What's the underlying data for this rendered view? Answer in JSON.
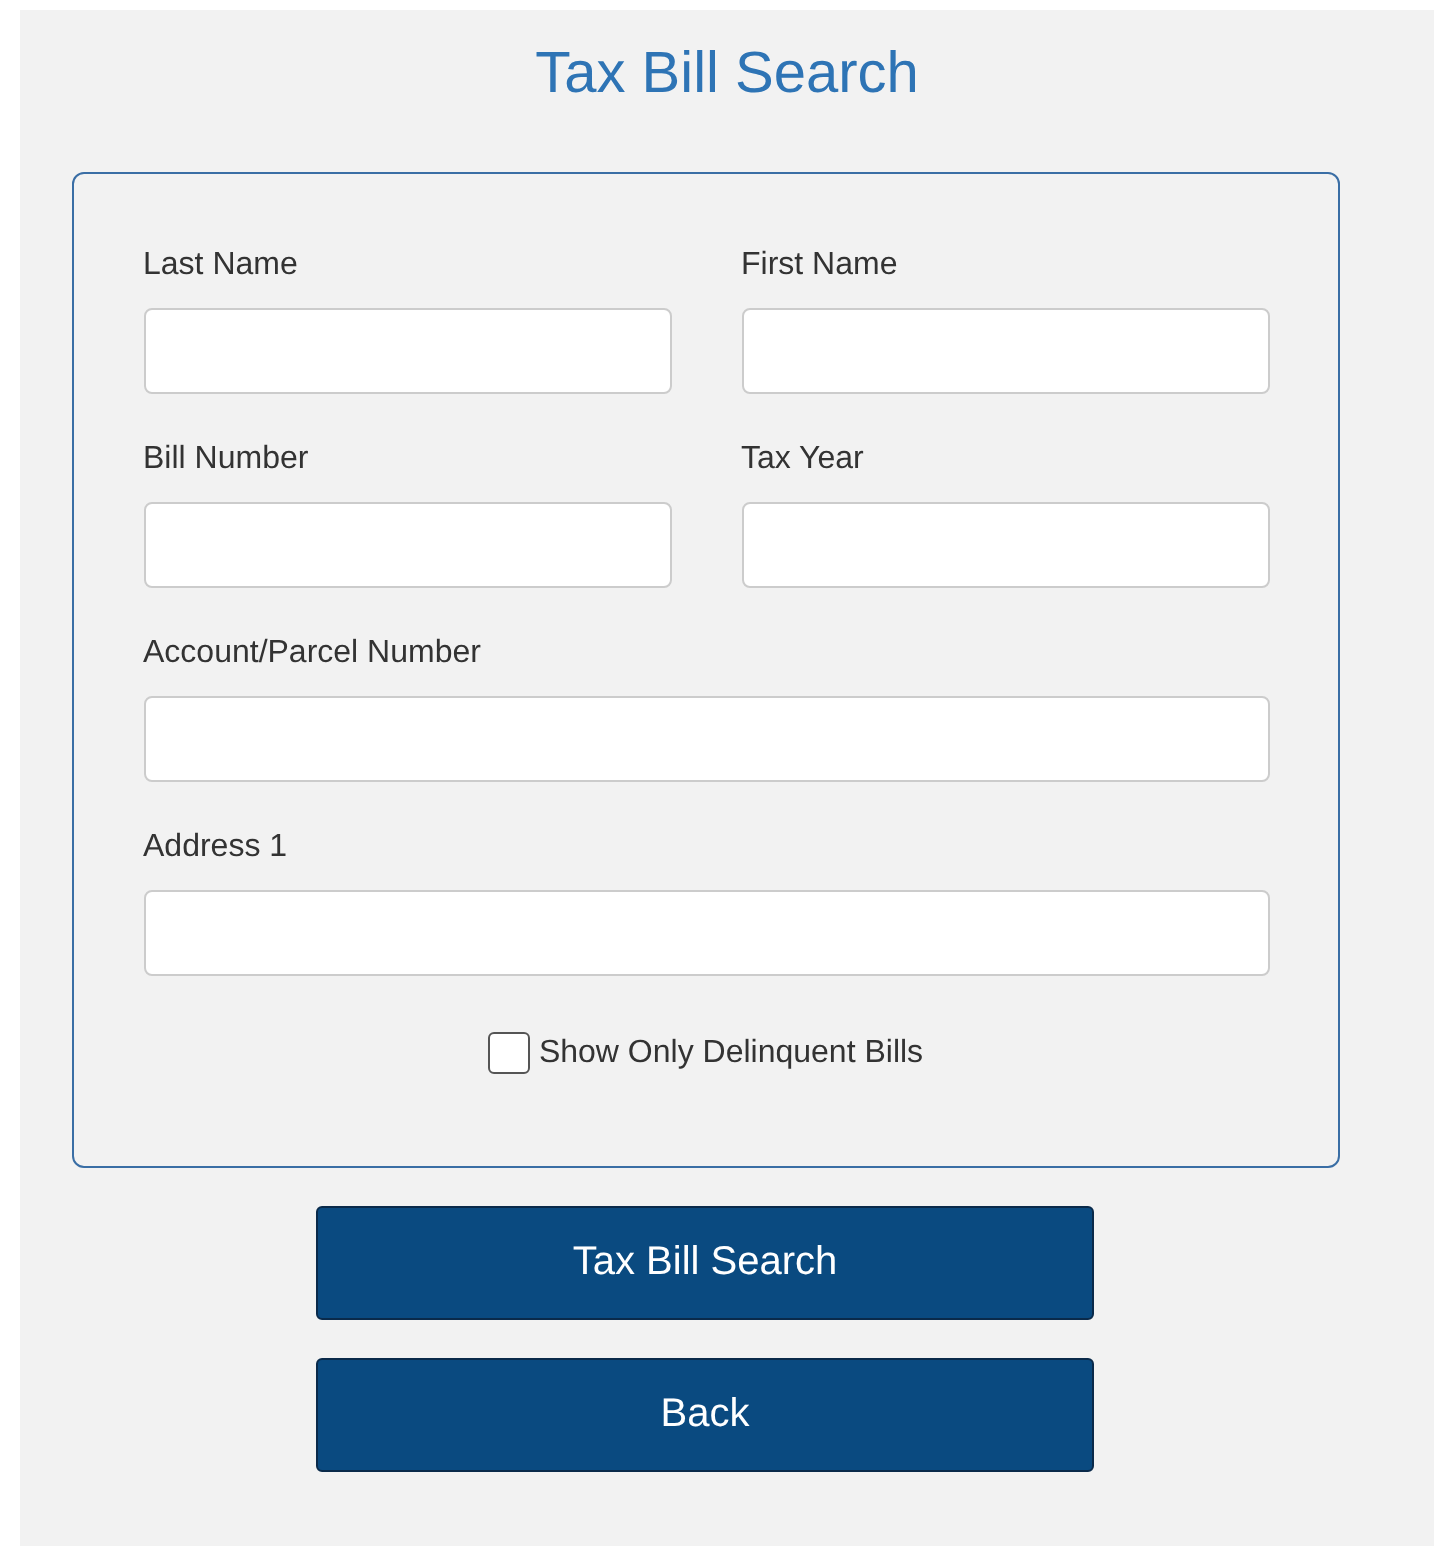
{
  "title": "Tax Bill Search",
  "fields": [
    {
      "label": "Last Name",
      "kind": "half"
    },
    {
      "label": "First Name",
      "kind": "half"
    },
    {
      "label": "Bill Number",
      "kind": "half"
    },
    {
      "label": "Tax Year",
      "kind": "half"
    },
    {
      "label": "Account/Parcel Number",
      "kind": "full"
    },
    {
      "label": "Address 1",
      "kind": "full"
    }
  ],
  "checkbox": {
    "label": "Show Only Delinquent Bills",
    "checked": false
  },
  "buttons": [
    "Tax Bill Search",
    "Back"
  ]
}
